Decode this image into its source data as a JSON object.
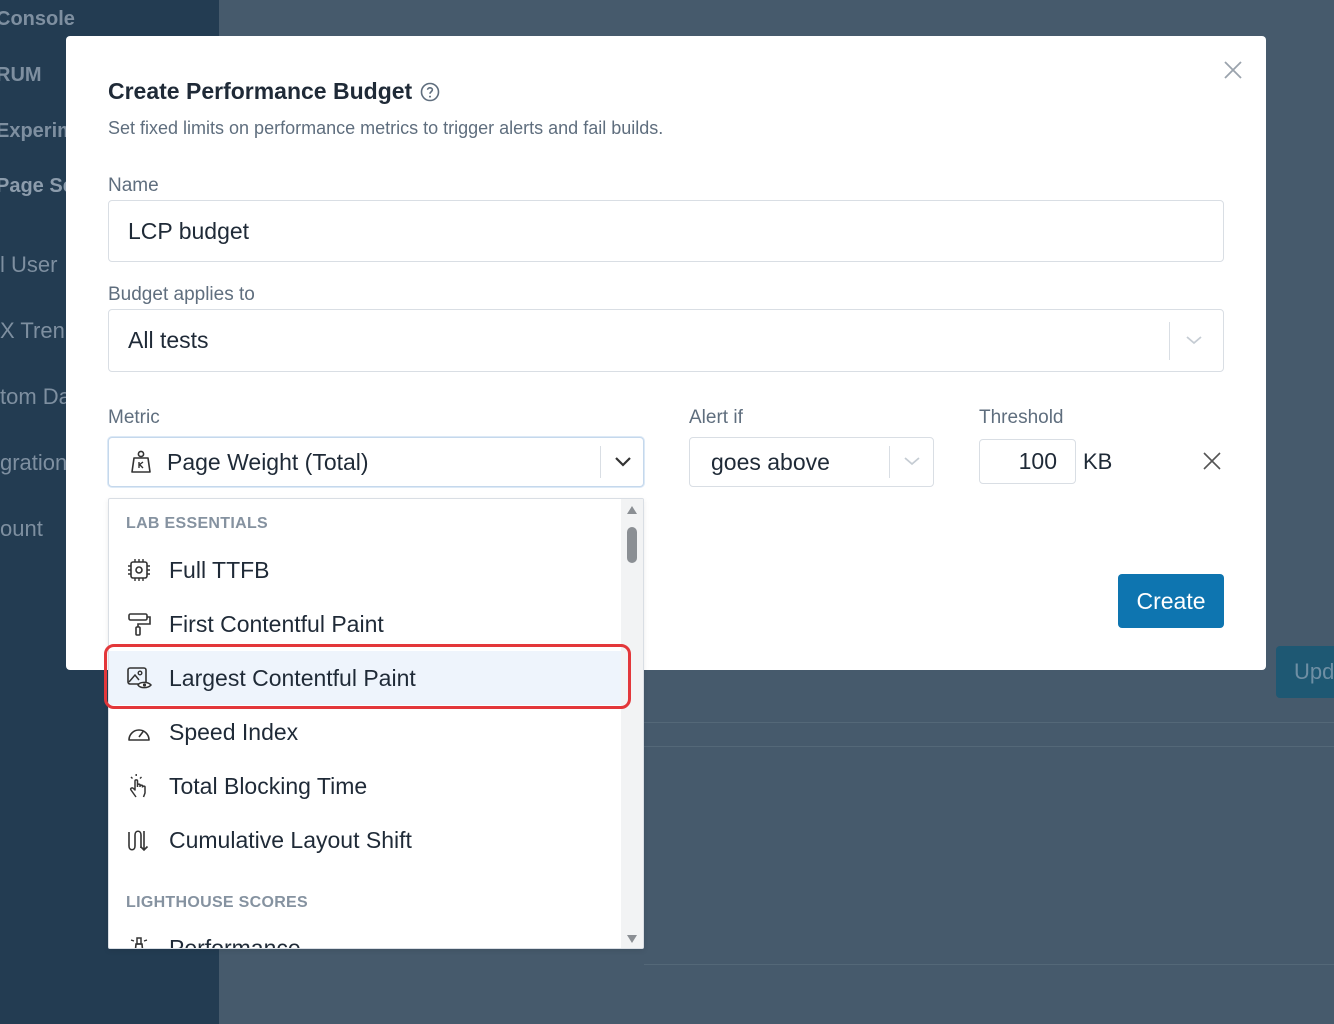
{
  "sidebar": {
    "items": [
      "Console",
      "RUM",
      "Experim",
      "Page Se",
      "l User",
      "X Tren",
      "tom Da",
      "gration",
      "ount"
    ]
  },
  "background": {
    "update_label": "Upd"
  },
  "modal": {
    "title": "Create Performance Budget",
    "subtitle": "Set fixed limits on performance metrics to trigger alerts and fail builds.",
    "name_label": "Name",
    "name_value": "LCP budget",
    "applies_label": "Budget applies to",
    "applies_value": "All tests",
    "metric_label": "Metric",
    "metric_value": "Page Weight (Total)",
    "alert_label": "Alert if",
    "alert_value": "goes above",
    "threshold_label": "Threshold",
    "threshold_value": "100",
    "threshold_unit": "KB",
    "create_label": "Create"
  },
  "dropdown": {
    "group1": "LAB ESSENTIALS",
    "options": [
      {
        "label": "Full TTFB",
        "icon": "chip-icon"
      },
      {
        "label": "First Contentful Paint",
        "icon": "paint-roller-icon"
      },
      {
        "label": "Largest Contentful Paint",
        "icon": "image-eye-icon",
        "selected": true
      },
      {
        "label": "Speed Index",
        "icon": "gauge-icon"
      },
      {
        "label": "Total Blocking Time",
        "icon": "hand-tap-icon"
      },
      {
        "label": "Cumulative Layout Shift",
        "icon": "layout-shift-icon"
      }
    ],
    "group2": "LIGHTHOUSE SCORES",
    "partial_option": "Performance"
  },
  "colors": {
    "accent": "#0e75b0",
    "highlight": "#e3373a",
    "selected_bg": "#eef4fc"
  }
}
